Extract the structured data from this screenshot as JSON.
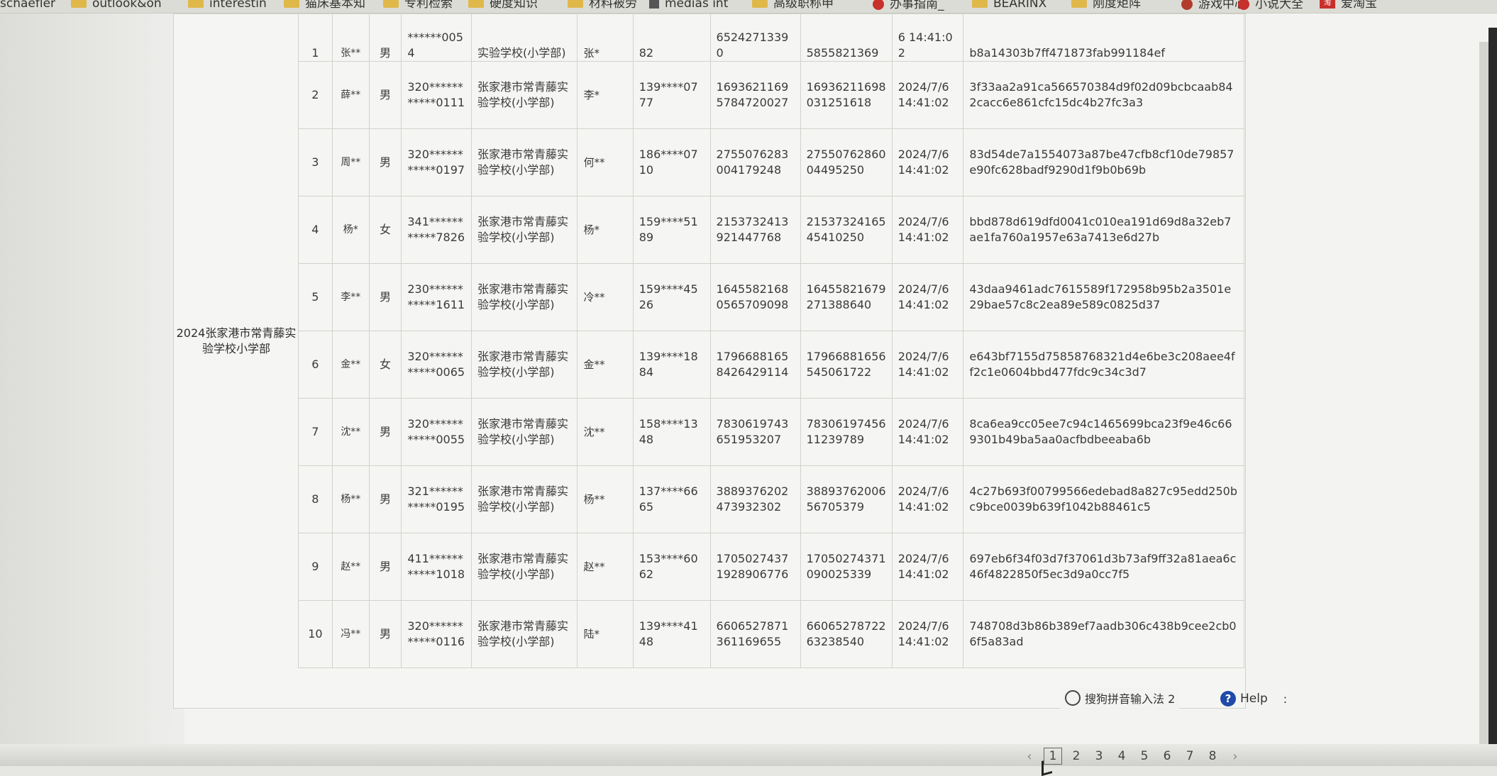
{
  "bookmarks": [
    {
      "label": "schaefler",
      "icon": "folder-icon"
    },
    {
      "label": "outlook&on",
      "icon": "folder-icon"
    },
    {
      "label": "interestin",
      "icon": "folder-icon"
    },
    {
      "label": "猫床基本知",
      "icon": "folder-icon"
    },
    {
      "label": "专利检索",
      "icon": "folder-icon"
    },
    {
      "label": "硬度知识",
      "icon": "folder-icon"
    },
    {
      "label": "材料被劳",
      "icon": "folder-icon"
    },
    {
      "label": "medias int",
      "icon": "document-icon"
    },
    {
      "label": "高级职称申",
      "icon": "folder-icon"
    },
    {
      "label": "办事指南_",
      "icon": "red-app-icon"
    },
    {
      "label": "BEARINX",
      "icon": "folder-icon"
    },
    {
      "label": "刚度矩阵",
      "icon": "folder-icon"
    },
    {
      "label": "游戏中心",
      "icon": "game-icon"
    },
    {
      "label": "小说大全",
      "icon": "red-app-icon"
    },
    {
      "label": "爱淘宝",
      "icon": "taobao-icon"
    }
  ],
  "group": {
    "label": "2024张家港市常青藤实验学校小学部"
  },
  "rows": [
    {
      "no": "1",
      "name": "张**",
      "sex": "男",
      "id": "******0054",
      "school": "实验学校(小学部)",
      "parent": "张*",
      "phone": "82",
      "a": "65242713390",
      "b": "5855821369",
      "date": "6 14:41:02",
      "hash": "b8a14303b7ff471873fab991184ef"
    },
    {
      "no": "2",
      "name": "薛**",
      "sex": "男",
      "id": "320***********0111",
      "school": "张家港市常青藤实验学校(小学部)",
      "parent": "李*",
      "phone": "139****0777",
      "a": "16936211695784720027",
      "b": "16936211698031251618",
      "date": "2024/7/6 14:41:02",
      "hash": "3f33aa2a91ca566570384d9f02d09bcbcaab842cacc6e861cfc15dc4b27fc3a3"
    },
    {
      "no": "3",
      "name": "周**",
      "sex": "男",
      "id": "320***********0197",
      "school": "张家港市常青藤实验学校(小学部)",
      "parent": "何**",
      "phone": "186****0710",
      "a": "2755076283004179248",
      "b": "2755076286004495250",
      "date": "2024/7/6 14:41:02",
      "hash": "83d54de7a1554073a87be47cfb8cf10de79857e90fc628badf9290d1f9b0b69b"
    },
    {
      "no": "4",
      "name": "杨*",
      "sex": "女",
      "id": "341***********7826",
      "school": "张家港市常青藤实验学校(小学部)",
      "parent": "杨*",
      "phone": "159****5189",
      "a": "2153732413921447768",
      "b": "2153732416545410250",
      "date": "2024/7/6 14:41:02",
      "hash": "bbd878d619dfd0041c010ea191d69d8a32eb7ae1fa760a1957e63a7413e6d27b"
    },
    {
      "no": "5",
      "name": "李**",
      "sex": "男",
      "id": "230***********1611",
      "school": "张家港市常青藤实验学校(小学部)",
      "parent": "冷**",
      "phone": "159****4526",
      "a": "16455821680565709098",
      "b": "16455821679271388640",
      "date": "2024/7/6 14:41:02",
      "hash": "43daa9461adc7615589f172958b95b2a3501e29bae57c8c2ea89e589c0825d37"
    },
    {
      "no": "6",
      "name": "金**",
      "sex": "女",
      "id": "320***********0065",
      "school": "张家港市常青藤实验学校(小学部)",
      "parent": "金**",
      "phone": "139****1884",
      "a": "17966881658426429114",
      "b": "17966881656545061722",
      "date": "2024/7/6 14:41:02",
      "hash": "e643bf7155d75858768321d4e6be3c208aee4ff2c1e0604bbd477fdc9c34c3d7"
    },
    {
      "no": "7",
      "name": "沈**",
      "sex": "男",
      "id": "320***********0055",
      "school": "张家港市常青藤实验学校(小学部)",
      "parent": "沈**",
      "phone": "158****1348",
      "a": "7830619743651953207",
      "b": "7830619745611239789",
      "date": "2024/7/6 14:41:02",
      "hash": "8ca6ea9cc05ee7c94c1465699bca23f9e46c669301b49ba5aa0acfbdbeeaba6b"
    },
    {
      "no": "8",
      "name": "杨**",
      "sex": "男",
      "id": "321***********0195",
      "school": "张家港市常青藤实验学校(小学部)",
      "parent": "杨**",
      "phone": "137****6665",
      "a": "3889376202473932302",
      "b": "3889376200656705379",
      "date": "2024/7/6 14:41:02",
      "hash": "4c27b693f00799566edebad8a827c95edd250bc9bce0039b639f1042b88461c5"
    },
    {
      "no": "9",
      "name": "赵**",
      "sex": "男",
      "id": "411***********1018",
      "school": "张家港市常青藤实验学校(小学部)",
      "parent": "赵**",
      "phone": "153****6062",
      "a": "17050274371928906776",
      "b": "17050274371090025339",
      "date": "2024/7/6 14:41:02",
      "hash": "697eb6f34f03d7f37061d3b73af9ff32a81aea6c46f4822850f5ec3d9a0cc7f5"
    },
    {
      "no": "10",
      "name": "冯**",
      "sex": "男",
      "id": "320***********0116",
      "school": "张家港市常青藤实验学校(小学部)",
      "parent": "陆*",
      "phone": "139****4148",
      "a": "6606527871361169655",
      "b": "6606527872263238540",
      "date": "2024/7/6 14:41:02",
      "hash": "748708d3b86b389ef7aadb306c438b9cee2cb06f5a83ad"
    }
  ],
  "ime": {
    "label": "搜狗拼音输入法 2"
  },
  "help": {
    "label": "Help"
  },
  "pagination": {
    "prev": "‹",
    "pages": [
      "1",
      "2",
      "3",
      "4",
      "5",
      "6",
      "7",
      "8"
    ],
    "current": "1",
    "next": "›"
  }
}
